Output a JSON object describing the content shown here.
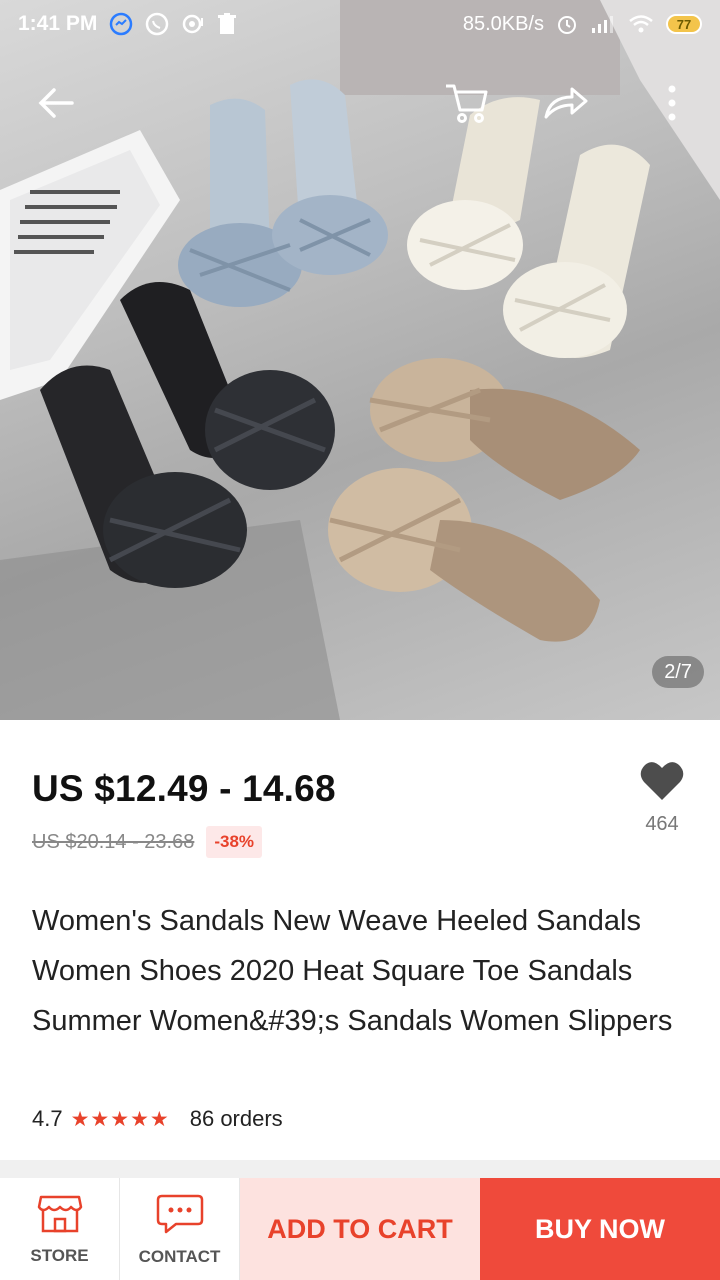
{
  "status_bar": {
    "time": "1:41 PM",
    "network_speed": "85.0KB/s",
    "battery": "77"
  },
  "gallery": {
    "counter": "2/7"
  },
  "product": {
    "price": "US $12.49 - 14.68",
    "original_price": "US $20.14 - 23.68",
    "discount": "-38%",
    "wishlist_count": "464",
    "title": "Women's Sandals New Weave Heeled Sandals Women Shoes 2020 Heat Square Toe Sandals Summer Women&#39;s Sandals Women Slippers",
    "rating": "4.7",
    "stars": "★★★★★",
    "orders": "86 orders"
  },
  "bottom_bar": {
    "store_label": "STORE",
    "contact_label": "CONTACT",
    "add_to_cart_label": "ADD TO CART",
    "buy_now_label": "BUY NOW"
  },
  "colors": {
    "accent": "#e8422b",
    "buy_now_bg": "#ef4a3b",
    "add_cart_bg": "#fde2df"
  }
}
